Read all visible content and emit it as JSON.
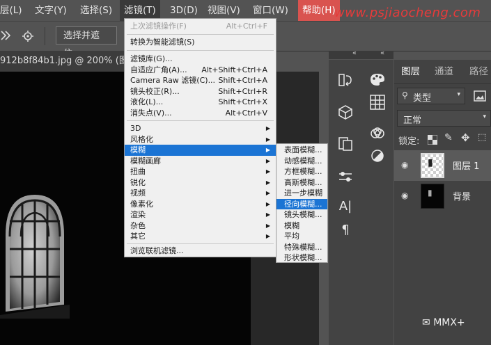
{
  "menubar": {
    "items": [
      "层(L)",
      "文字(Y)",
      "选择(S)",
      "滤镜(T)",
      "3D(D)",
      "视图(V)",
      "窗口(W)",
      "帮助(H)"
    ],
    "watermark": "www.psjiaocheng.com"
  },
  "optionsbar": {
    "select_mask": "选择并遮住..."
  },
  "document": {
    "tab_title": "912b8f84b1.jpg @ 200% (图"
  },
  "filter_menu": {
    "last_filter": {
      "label": "上次滤镜操作(F)",
      "shortcut": "Alt+Ctrl+F"
    },
    "convert_smart": "转换为智能滤镜(S)",
    "group1": [
      {
        "label": "滤镜库(G)...",
        "shortcut": ""
      },
      {
        "label": "自适应广角(A)...",
        "shortcut": "Alt+Shift+Ctrl+A"
      },
      {
        "label": "Camera Raw 滤镜(C)...",
        "shortcut": "Shift+Ctrl+A"
      },
      {
        "label": "镜头校正(R)...",
        "shortcut": "Shift+Ctrl+R"
      },
      {
        "label": "液化(L)...",
        "shortcut": "Shift+Ctrl+X"
      },
      {
        "label": "消失点(V)...",
        "shortcut": "Alt+Ctrl+V"
      }
    ],
    "group2": [
      "3D",
      "风格化",
      "模糊",
      "模糊画廊",
      "扭曲",
      "锐化",
      "视频",
      "像素化",
      "渲染",
      "杂色",
      "其它"
    ],
    "browse_online": "浏览联机滤镜..."
  },
  "blur_submenu": [
    "表面模糊...",
    "动感模糊...",
    "方框模糊...",
    "高斯模糊...",
    "进一步模糊",
    "径向模糊...",
    "镜头模糊...",
    "模糊",
    "平均",
    "特殊模糊...",
    "形状模糊..."
  ],
  "layers_panel": {
    "tabs": [
      "图层",
      "通道",
      "路径"
    ],
    "kind_filter": "类型",
    "blend_mode": "正常",
    "lock_label": "锁定:",
    "layers": [
      {
        "name": "图层 1"
      },
      {
        "name": "背景"
      }
    ]
  },
  "overlay": {
    "wechat_label": "MMX+"
  },
  "colors": {
    "highlight": "#1b74d4",
    "menu_bg": "#f0f0f0",
    "panel_bg": "#424242"
  }
}
